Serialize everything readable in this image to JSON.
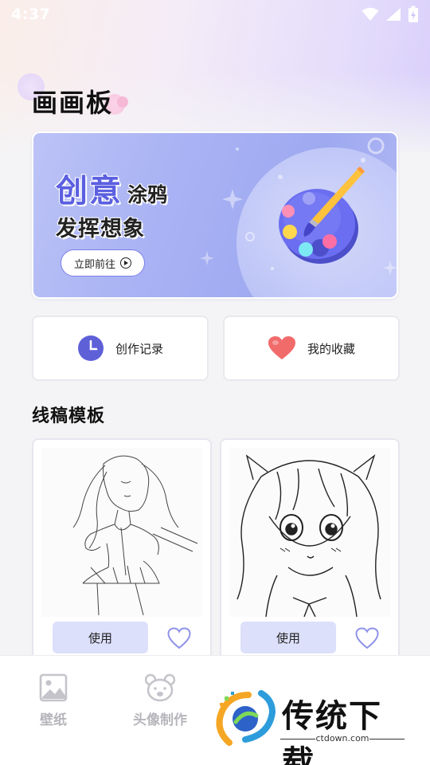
{
  "status_bar": {
    "time": "4:37"
  },
  "page_title": "画画板",
  "banner": {
    "headline_accent": "创意",
    "headline_rest": "涂鸦",
    "subline": "发挥想象",
    "button_label": "立即前往"
  },
  "quick_actions": [
    {
      "label": "创作记录",
      "icon": "clock-icon"
    },
    {
      "label": "我的收藏",
      "icon": "heart-icon"
    }
  ],
  "templates_section": {
    "title": "线稿模板",
    "cards": [
      {
        "image": "anime-girl-lineart",
        "use_label": "使用",
        "favorite_icon": "heart-outline-icon"
      },
      {
        "image": "anime-chibi-girl-lineart",
        "use_label": "使用",
        "favorite_icon": "heart-outline-icon"
      }
    ]
  },
  "bottom_nav": {
    "items": [
      {
        "label": "壁纸",
        "icon": "image-icon"
      },
      {
        "label": "头像制作",
        "icon": "bear-face-icon"
      }
    ]
  },
  "watermark": {
    "text": "传统下载",
    "url": "ctdown.com"
  },
  "colors": {
    "accent": "#5b5fe0",
    "button_bg": "#dde0fb",
    "heart": "#f06a6a"
  }
}
